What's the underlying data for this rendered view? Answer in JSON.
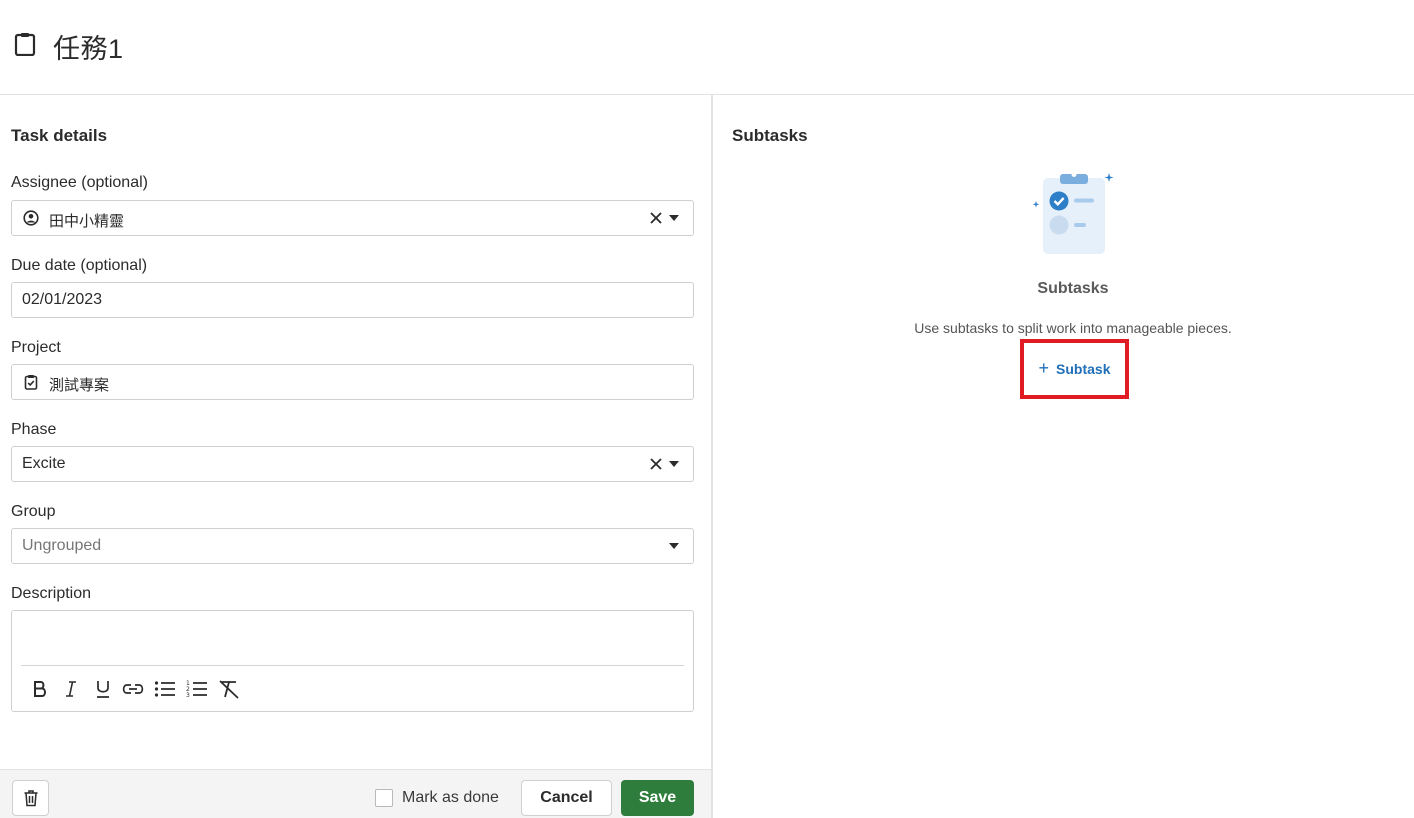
{
  "header": {
    "title": "任務1",
    "icon": "clipboard-icon"
  },
  "task_details": {
    "heading": "Task details",
    "assignee": {
      "label": "Assignee (optional)",
      "value": "田中小精靈",
      "icon": "user-circle-icon"
    },
    "due_date": {
      "label": "Due date (optional)",
      "value": "02/01/2023"
    },
    "project": {
      "label": "Project",
      "value": "測試專案",
      "icon": "clipboard-check-icon"
    },
    "phase": {
      "label": "Phase",
      "value": "Excite"
    },
    "group": {
      "label": "Group",
      "value": "Ungrouped"
    },
    "description": {
      "label": "Description",
      "value": "",
      "toolbar": [
        "bold-icon",
        "italic-icon",
        "underline-icon",
        "link-icon",
        "bullet-list-icon",
        "numbered-list-icon",
        "clear-format-icon"
      ]
    }
  },
  "footer": {
    "mark_done_label": "Mark as done",
    "mark_done_checked": false,
    "cancel_label": "Cancel",
    "save_label": "Save"
  },
  "subtasks": {
    "heading": "Subtasks",
    "empty_title": "Subtasks",
    "empty_description": "Use subtasks to split work into manageable pieces.",
    "add_button_label": "Subtask",
    "add_button_icon": "plus-icon"
  },
  "colors": {
    "save_button": "#2e7d3c",
    "link_blue": "#1f6fb8",
    "highlight_red": "#e01b24"
  }
}
